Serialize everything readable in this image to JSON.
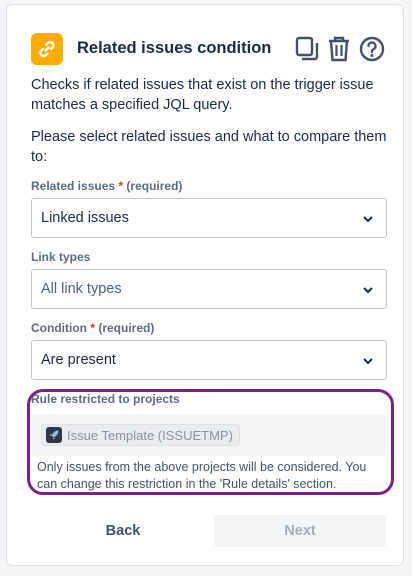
{
  "header": {
    "title": "Related issues condition",
    "icon": "link-icon",
    "actions": [
      "copy-icon",
      "trash-icon",
      "help-icon"
    ]
  },
  "description": "Checks if related issues that exist on the trigger issue matches a specified JQL query.",
  "prompt": "Please select related issues and what to compare them to:",
  "fields": {
    "related_issues": {
      "label": "Related issues",
      "required_star": "*",
      "required_text": "(required)",
      "value": "Linked issues"
    },
    "link_types": {
      "label": "Link types",
      "value": "All link types"
    },
    "condition": {
      "label": "Condition",
      "required_star": "*",
      "required_text": "(required)",
      "value": "Are present"
    }
  },
  "restriction": {
    "label": "Rule restricted to projects",
    "project": "Issue Template (ISSUETMP)",
    "note": "Only issues from the above projects will be considered. You can change this restriction in the 'Rule details' section."
  },
  "buttons": {
    "back": "Back",
    "next": "Next"
  },
  "colors": {
    "accent_icon_bg": "#ffab00",
    "required_star": "#de350b",
    "highlight_border": "#7b2382",
    "text_primary": "#172b4d"
  }
}
